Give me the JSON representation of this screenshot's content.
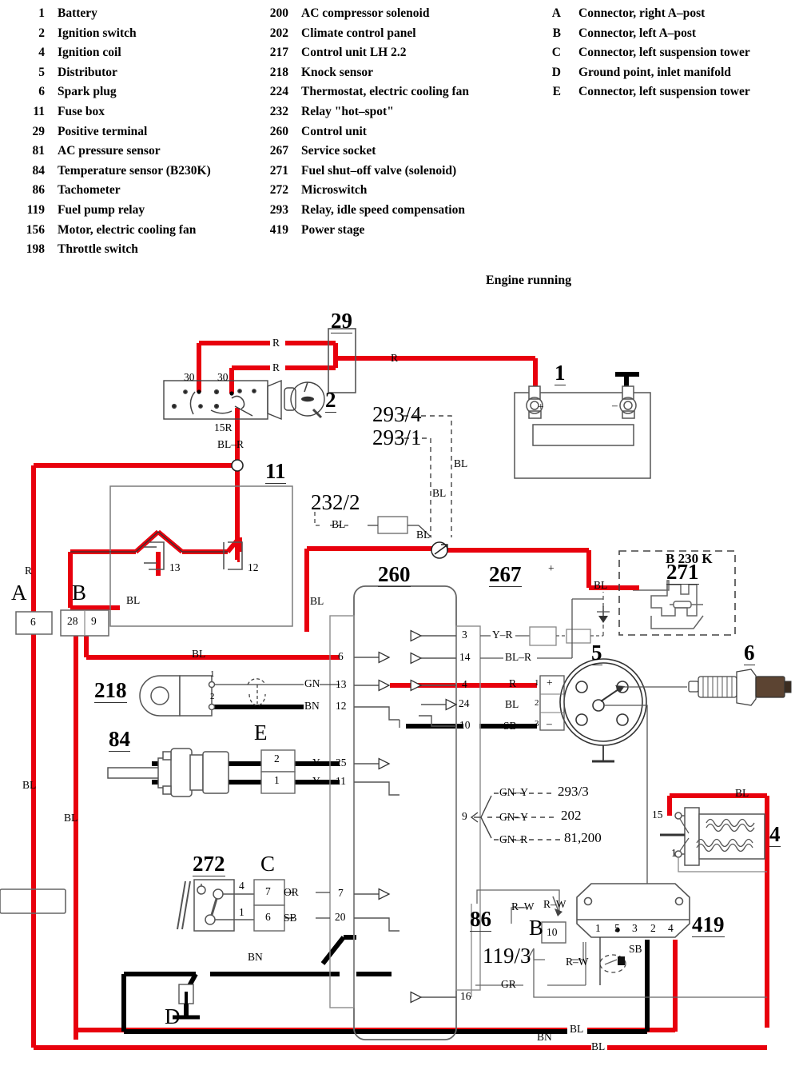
{
  "title": "Engine running",
  "legend": {
    "column1": [
      {
        "num": "1",
        "label": "Battery"
      },
      {
        "num": "2",
        "label": "Ignition switch"
      },
      {
        "num": "4",
        "label": "Ignition coil"
      },
      {
        "num": "5",
        "label": "Distributor"
      },
      {
        "num": "6",
        "label": "Spark plug"
      },
      {
        "num": "11",
        "label": "Fuse box"
      },
      {
        "num": "29",
        "label": "Positive terminal"
      },
      {
        "num": "81",
        "label": "AC pressure sensor"
      },
      {
        "num": "84",
        "label": "Temperature sensor (B230K)"
      },
      {
        "num": "86",
        "label": "Tachometer"
      },
      {
        "num": "119",
        "label": "Fuel pump relay"
      },
      {
        "num": "156",
        "label": "Motor, electric cooling fan"
      },
      {
        "num": "198",
        "label": "Throttle switch"
      }
    ],
    "column2": [
      {
        "num": "200",
        "label": "AC compressor solenoid"
      },
      {
        "num": "202",
        "label": "Climate control panel"
      },
      {
        "num": "217",
        "label": "Control unit LH 2.2"
      },
      {
        "num": "218",
        "label": "Knock sensor"
      },
      {
        "num": "224",
        "label": "Thermostat, electric cooling fan"
      },
      {
        "num": "232",
        "label": "Relay \"hot–spot\""
      },
      {
        "num": "260",
        "label": "Control unit"
      },
      {
        "num": "267",
        "label": "Service socket"
      },
      {
        "num": "271",
        "label": "Fuel shut–off valve (solenoid)"
      },
      {
        "num": "272",
        "label": "Microswitch"
      },
      {
        "num": "293",
        "label": "Relay, idle speed compensation"
      },
      {
        "num": "419",
        "label": "Power stage"
      }
    ],
    "column3": [
      {
        "num": "A",
        "label": "Connector, right A–post"
      },
      {
        "num": "B",
        "label": "Connector, left A–post"
      },
      {
        "num": "C",
        "label": "Connector, left suspension tower"
      },
      {
        "num": "D",
        "label": "Ground point, inlet manifold"
      },
      {
        "num": "E",
        "label": "Connector, left suspension tower"
      }
    ]
  },
  "colors": {
    "wire_red": "#e8000d",
    "wire_black": "#000000",
    "outline": "#5a5a5a",
    "text": "#1a1a1a"
  },
  "components": {
    "positive_terminal": "29",
    "battery": "1",
    "ignition_switch": "2",
    "fuse_box": "11",
    "control_unit": "260",
    "service_socket": "267",
    "fuel_shutoff_valve": "271",
    "b230k_box": "B 230 K",
    "distributor": "5",
    "spark_plug": "6",
    "knock_sensor": "218",
    "temp_sensor": "84",
    "ignition_coil": "4",
    "microswitch": "272",
    "tachometer": "86",
    "power_stage": "419",
    "relay_hotspot": "232/2",
    "relay_idle_4": "293/4",
    "relay_idle_1": "293/1",
    "fuel_pump_relay": "119/3",
    "connector_A": "A",
    "connector_B": "B",
    "connector_C": "C",
    "ground_D": "D",
    "connector_E": "E"
  },
  "wire_labels": {
    "r_top1": "R",
    "r_top2": "R",
    "r_terminal_out": "R",
    "terminal_30a": "30",
    "terminal_30b": "30",
    "terminal_15r": "15R",
    "bl_r_switch": "BL–R",
    "fuse13": "13",
    "fuse12": "12",
    "bl_fuse": "BL",
    "bl_293_upper": "BL",
    "bl_293_lower": "BL",
    "bl_232": "BL",
    "bl_232_right": "BL",
    "bl_left_a": "R",
    "bl_a_down": "BL",
    "bl_b_down": "BL",
    "bl_to260": "BL",
    "bl_pin6": "BL",
    "bl_271": "BL",
    "connA_pin": "6",
    "connB_pin1": "28",
    "connB_pin2": "9",
    "knock_1": "1",
    "knock_2": "2",
    "gn": "GN",
    "bn_knock": "BN",
    "e_pin2": "2",
    "e_pin1": "1",
    "y_25": "Y",
    "y_11": "Y",
    "pin_6": "6",
    "pin_13": "13",
    "pin_12": "12",
    "pin_25": "25",
    "pin_11": "11",
    "pin_7": "7",
    "pin_20": "20",
    "pin_3": "3",
    "pin_14": "14",
    "pin_4": "4",
    "pin_24": "24",
    "pin_10": "10",
    "pin_9": "9",
    "pin_16": "16",
    "y_r": "Y–R",
    "bl_r_14": "BL–R",
    "r_4": "R",
    "bl_24": "BL",
    "sb_10": "SB",
    "dist_plus": "+",
    "dist_1": "1",
    "dist_2": "2",
    "dist_3": "3",
    "dist_minus": "–",
    "batt_plus": "+",
    "batt_minus": "–",
    "socket_plus": "+",
    "branch_gny_293": "GN–Y",
    "branch_293_3": "293/3",
    "branch_gny_202": "GN–Y",
    "branch_202": "202",
    "branch_gnr": "GN–R",
    "branch_81200": "81,200",
    "coil_15": "15",
    "coil_1": "1",
    "bl_coil": "BL",
    "ms_4": "4",
    "ms_1": "1",
    "c_7": "7",
    "c_6": "6",
    "or": "OR",
    "sb_c": "SB",
    "bn_ground": "BN",
    "rw_1": "R–W",
    "rw_2": "R–W",
    "rw_3": "R–W",
    "b_10": "10",
    "gr": "GR",
    "sb_419": "SB",
    "ps_1": "1",
    "ps_5": "5",
    "ps_3": "3",
    "ps_2": "2",
    "ps_4": "4",
    "bn_bottom": "BN",
    "bl_bottom1": "BL",
    "bl_bottom2": "BL"
  }
}
